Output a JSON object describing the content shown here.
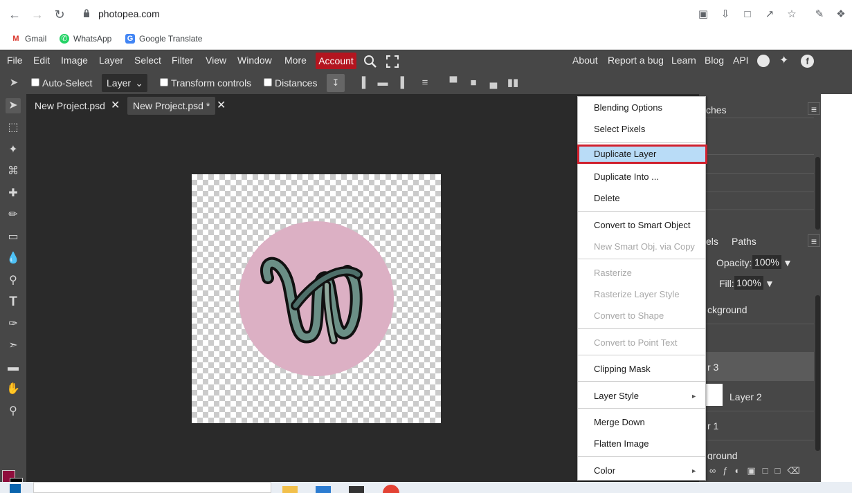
{
  "browser": {
    "url": "photopea.com",
    "bookmarks": [
      "Gmail",
      "WhatsApp",
      "Google Translate"
    ]
  },
  "menu": [
    "File",
    "Edit",
    "Image",
    "Layer",
    "Select",
    "Filter",
    "View",
    "Window",
    "More"
  ],
  "account_label": "Account",
  "right_links": [
    "About",
    "Report a bug",
    "Learn",
    "Blog",
    "API"
  ],
  "options": {
    "auto_select": "Auto-Select",
    "layer_dropdown": "Layer",
    "transform_controls": "Transform controls",
    "distances": "Distances"
  },
  "tabs": [
    "New Project.psd",
    "New Project.psd *"
  ],
  "panels": {
    "swatches_partial": "ches",
    "channels_partial": "els",
    "paths": "Paths",
    "opacity_label": "Opacity:",
    "opacity_value": "100%",
    "fill_label": "Fill:",
    "fill_value": "100%",
    "layers": [
      "ckground",
      "r 3",
      "Layer 2",
      "r 1",
      "ground"
    ]
  },
  "context_menu": {
    "items": [
      {
        "label": "Blending Options",
        "disabled": false
      },
      {
        "label": "Select Pixels",
        "disabled": false
      },
      {
        "label": "Duplicate Layer",
        "disabled": false,
        "highlighted": true
      },
      {
        "label": "Duplicate Into ...",
        "disabled": false
      },
      {
        "label": "Delete",
        "disabled": false
      },
      {
        "label": "Convert to Smart Object",
        "disabled": false
      },
      {
        "label": "New Smart Obj. via Copy",
        "disabled": true
      },
      {
        "label": "Rasterize",
        "disabled": true
      },
      {
        "label": "Rasterize Layer Style",
        "disabled": true
      },
      {
        "label": "Convert to Shape",
        "disabled": true
      },
      {
        "label": "Convert to Point Text",
        "disabled": true
      },
      {
        "label": "Clipping Mask",
        "disabled": false
      },
      {
        "label": "Layer Style",
        "disabled": false,
        "submenu": true
      },
      {
        "label": "Merge Down",
        "disabled": false
      },
      {
        "label": "Flatten Image",
        "disabled": false
      },
      {
        "label": "Color",
        "disabled": false,
        "submenu": true
      }
    ]
  },
  "colors": {
    "accent_red": "#b3151f",
    "foreground_swatch": "#8e0d3c",
    "circle_pink": "#dcb0c4",
    "highlight_blue": "#b9dcf7"
  }
}
